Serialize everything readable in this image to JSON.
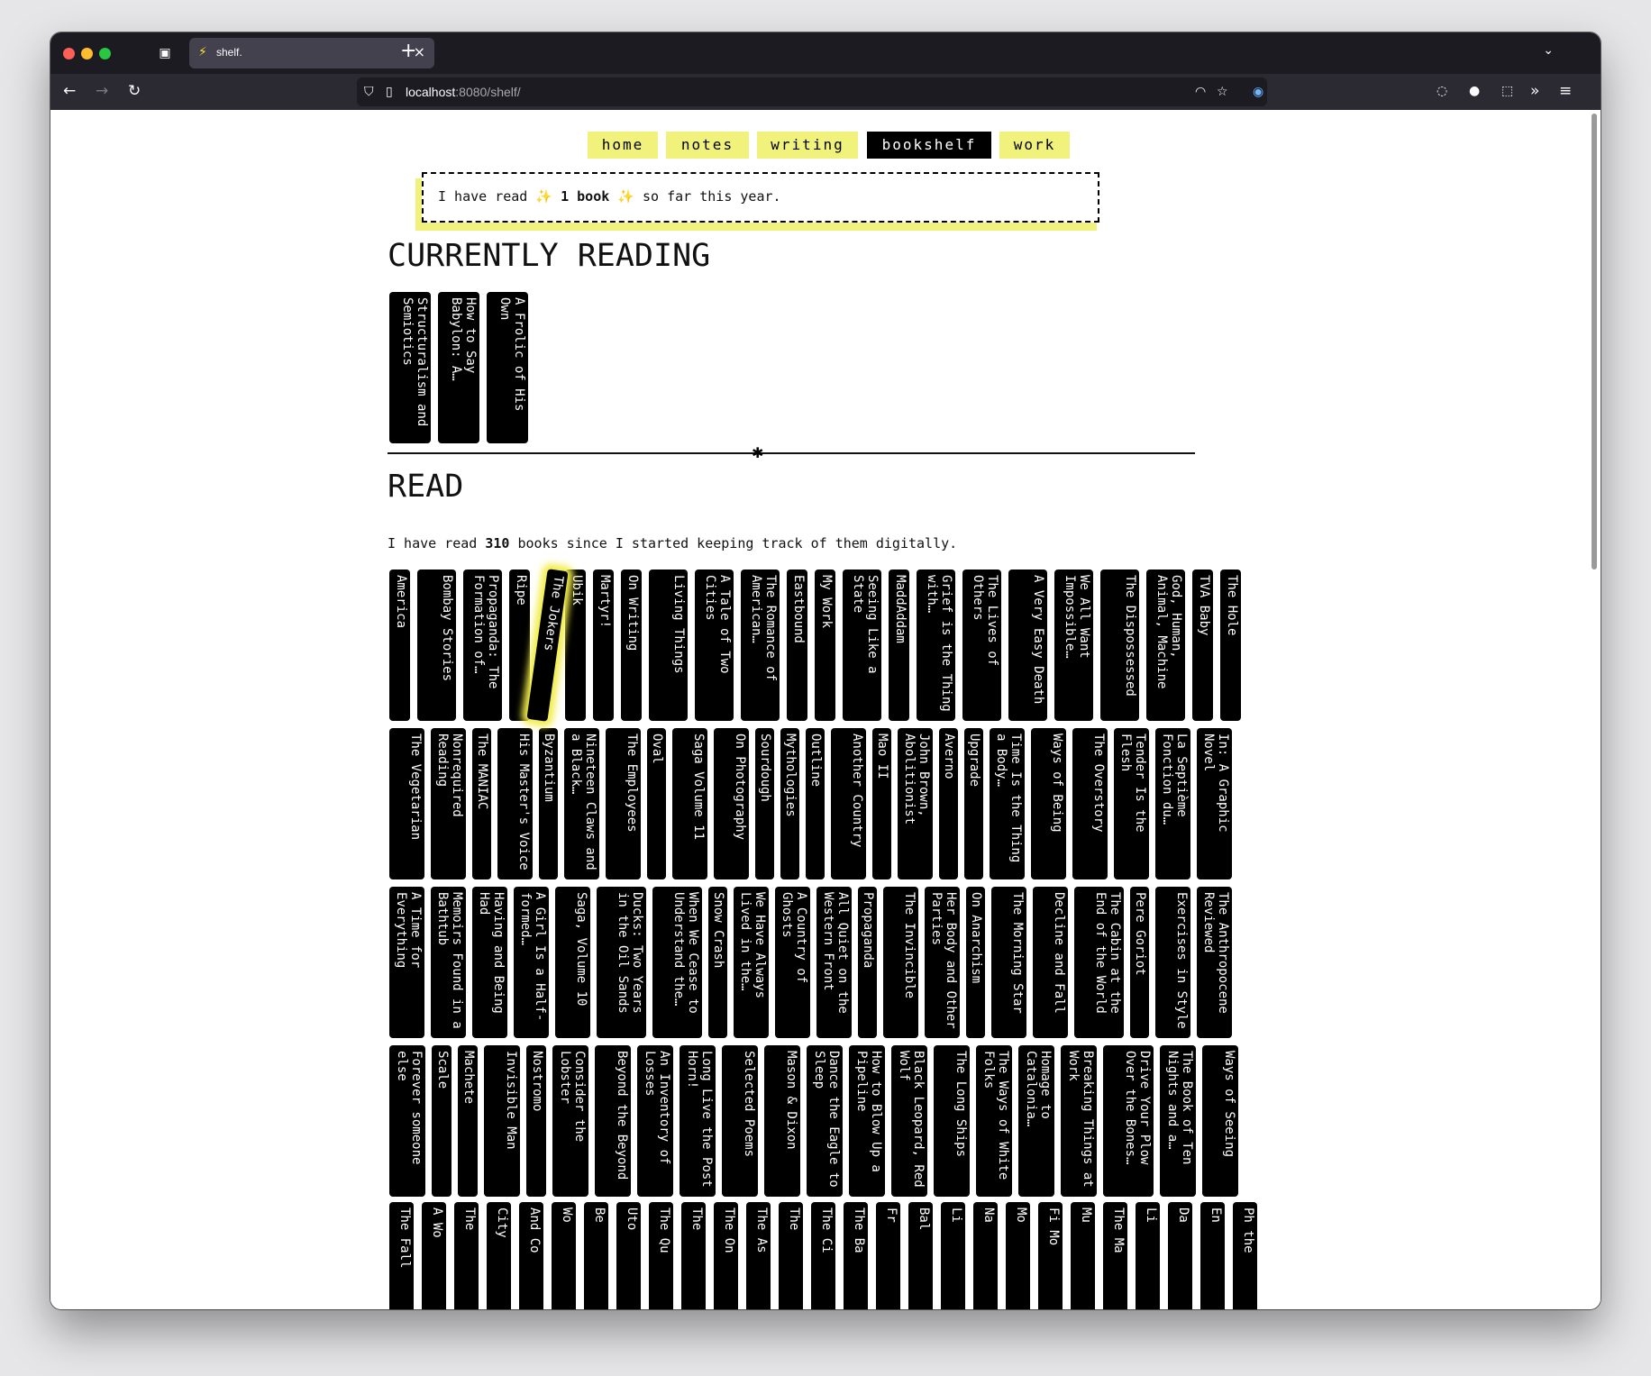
{
  "browser": {
    "tab_title": "shelf.",
    "tab_favicon": "⚡",
    "url_host": "localhost",
    "url_rest": ":8080/shelf/",
    "icons": [
      "tab-overview-icon",
      "close-icon",
      "new-tab-icon",
      "tab-list-icon",
      "back-icon",
      "forward-icon",
      "reload-icon",
      "tracking-shield-icon",
      "page-info-icon",
      "rss-icon",
      "bookmark-star-icon",
      "password-manager-icon",
      "pocket-icon",
      "account-icon",
      "extensions-icon",
      "overflow-icon",
      "menu-icon"
    ]
  },
  "colors": {
    "accent": "#f0f27c",
    "spine": "#000000",
    "highlight": "#f2ee4a"
  },
  "nav": [
    {
      "label": "home"
    },
    {
      "label": "notes"
    },
    {
      "label": "writing"
    },
    {
      "label": "bookshelf",
      "active": true
    },
    {
      "label": "work"
    }
  ],
  "callout": {
    "pre": "I have read ",
    "emoji": "✨",
    "strong": "1 book",
    "post": " so far this year."
  },
  "currently_reading": {
    "heading": "CURRENTLY READING",
    "books": [
      "Structuralism and Semiotics",
      "How to Say Babylon: A…",
      "A Frolic of His Own"
    ]
  },
  "divider_symbol": "✱",
  "read": {
    "heading": "READ",
    "count_pre": "I have read ",
    "count": "310",
    "count_post": " books since I started keeping track of them digitally.",
    "highlighted": "The Jokers",
    "rows": [
      [
        "America",
        "Bombay Stories",
        "Propaganda: The Formation of…",
        "Ripe",
        "The Jokers",
        "Ubik",
        "Martyr!",
        "On Writing",
        "Living Things",
        "A Tale of Two Cities",
        "The Romance of American…",
        "Eastbound",
        "My Work",
        "Seeing Like a State",
        "MaddAddam",
        "Grief is the Thing with…",
        "The Lives of Others",
        "A Very Easy Death",
        "We All Want Impossible…",
        "The Dispossessed",
        "God, Human, Animal, Machine",
        "TVA Baby",
        "The Hole"
      ],
      [
        "The Vegetarian",
        "Nonrequired Reading",
        "The MANIAC",
        "His Master's Voice",
        "Byzantium",
        "Nineteen Claws and a Black…",
        "The Employees",
        "Oval",
        "Saga Volume 11",
        "On Photography",
        "Sourdough",
        "Mythologies",
        "Outline",
        "Another Country",
        "Mao II",
        "John Brown, Abolitionist",
        "Averno",
        "Upgrade",
        "Time Is the Thing a Body…",
        "Ways of Being",
        "The Overstory",
        "Tender Is the Flesh",
        "La Septième Fonction du…",
        "In: A Graphic Novel"
      ],
      [
        "A Time for Everything",
        "Memoirs Found in a Bathtub",
        "Having and Being Had",
        "A Girl Is a Half-formed…",
        "Saga, Volume 10",
        "Ducks: Two Years in the Oil Sands",
        "When We Cease to Understand the…",
        "Snow Crash",
        "We Have Always Lived in the…",
        "A Country of Ghosts",
        "All Quiet on the Western Front",
        "Propaganda",
        "The Invincible",
        "Her Body and Other Parties",
        "On Anarchism",
        "The Morning Star",
        "Decline and Fall",
        "The Cabin at the End of the World",
        "Pere Goriot",
        "Exercises in Style",
        "The Anthropocene Reviewed"
      ],
      [
        "Forever someone else",
        "Scale",
        "Machete",
        "Invisible Man",
        "Nostromo",
        "Consider the Lobster",
        "Beyond the Beyond",
        "An Inventory of Losses",
        "Long Live the Post Horn!",
        "Selected Poems",
        "Mason & Dixon",
        "Dance the Eagle to Sleep",
        "How to Blow Up a Pipeline",
        "Black Leopard, Red Wolf",
        "The Long Ships",
        "The Ways of White Folks",
        "Homage to Catalonia…",
        "Breaking Things at Work",
        "Drive Your Plow Over the Bones…",
        "The Book of Ten Nights and a…",
        "Ways of Seeing"
      ],
      [
        "The Fall",
        "A Wo",
        "The",
        "City",
        "And Co",
        "Wo",
        "Be",
        "Uto",
        "The Qu",
        "The",
        "The On",
        "The As",
        "The",
        "The Ci",
        "The Ba",
        "Fr",
        "Bal",
        "Li",
        "Na",
        "Mo",
        "Fi Mo",
        "Mu",
        "The Ma",
        "Li",
        "Da",
        "En",
        "Ph the"
      ]
    ]
  }
}
